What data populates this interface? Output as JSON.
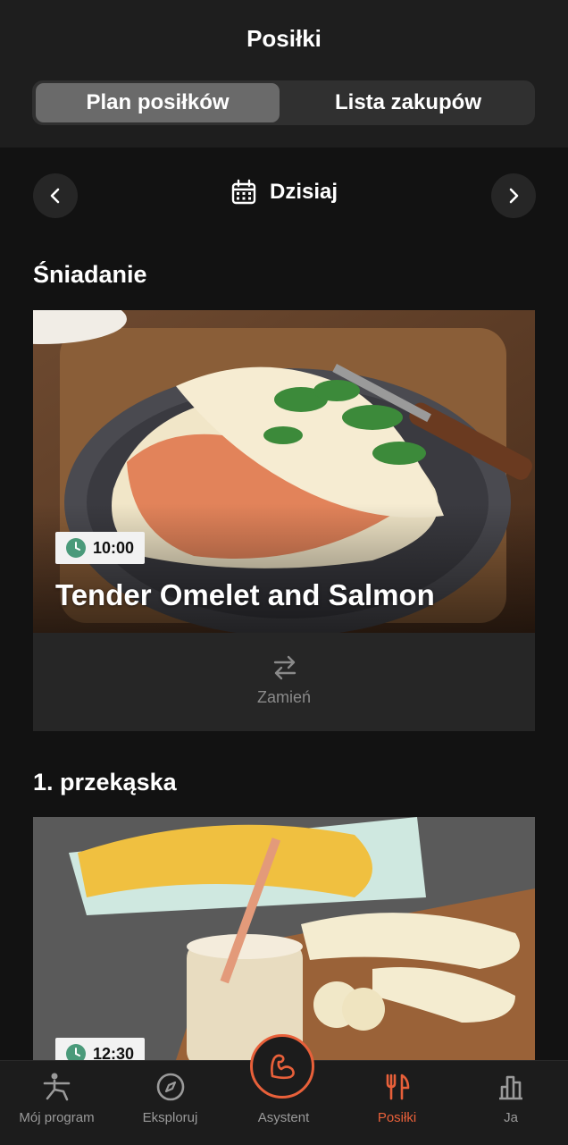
{
  "header": {
    "title": "Posiłki",
    "tabs": [
      {
        "label": "Plan posiłków",
        "active": true
      },
      {
        "label": "Lista zakupów",
        "active": false
      }
    ]
  },
  "date_nav": {
    "label": "Dzisiaj",
    "prev_icon": "chevron-left-icon",
    "next_icon": "chevron-right-icon",
    "calendar_icon": "calendar-icon"
  },
  "meals": [
    {
      "section": "Śniadanie",
      "time": "10:00",
      "name": "Tender Omelet and Salmon",
      "swap_label": "Zamień"
    },
    {
      "section": "1. przekąska",
      "time": "12:30"
    }
  ],
  "tabbar": {
    "items": [
      {
        "label": "Mój program",
        "icon": "yoga-pose-icon",
        "active": false
      },
      {
        "label": "Eksploruj",
        "icon": "compass-icon",
        "active": false
      },
      {
        "label": "Asystent",
        "icon": "flexed-arm-icon",
        "active": false
      },
      {
        "label": "Posiłki",
        "icon": "fork-knife-icon",
        "active": true
      },
      {
        "label": "Ja",
        "icon": "bar-chart-icon",
        "active": false
      }
    ]
  },
  "colors": {
    "accent": "#e8603a",
    "background": "#121212",
    "header_bg": "#1e1e1e",
    "clock": "#4a9a7a"
  }
}
